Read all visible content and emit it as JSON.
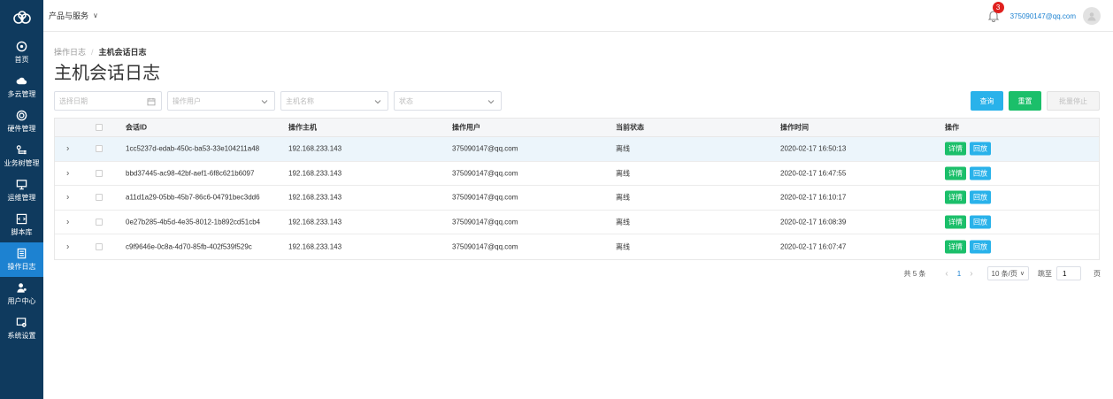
{
  "sidebar": {
    "logo_icon": "cloud-rings-logo-icon",
    "items": [
      {
        "label": "首页",
        "icon": "dashboard-icon"
      },
      {
        "label": "多云管理",
        "icon": "cloud-icon"
      },
      {
        "label": "硬件管理",
        "icon": "gear-ring-icon"
      },
      {
        "label": "业务树管理",
        "icon": "tree-icon"
      },
      {
        "label": "运维管理",
        "icon": "monitor-icon"
      },
      {
        "label": "脚本库",
        "icon": "code-icon"
      },
      {
        "label": "操作日志",
        "icon": "document-icon",
        "active": true
      },
      {
        "label": "用户中心",
        "icon": "user-icon"
      },
      {
        "label": "系统设置",
        "icon": "settings-icon"
      }
    ]
  },
  "topbar": {
    "product_menu": "产品与服务",
    "notification_count": "3",
    "user_email": "375090147@qq.com"
  },
  "breadcrumb": {
    "parent": "操作日志",
    "separator": "/",
    "current": "主机会话日志"
  },
  "page_title": "主机会话日志",
  "filters": {
    "date_placeholder": "选择日期",
    "user_placeholder": "操作用户",
    "host_placeholder": "主机名称",
    "status_placeholder": "状态"
  },
  "buttons": {
    "query": "查询",
    "reset": "重置",
    "batch_stop": "批量停止"
  },
  "table": {
    "headers": {
      "session_id": "会话ID",
      "host": "操作主机",
      "user": "操作用户",
      "status": "当前状态",
      "time": "操作时间",
      "actions": "操作"
    },
    "action_labels": {
      "detail": "详情",
      "replay": "回放"
    },
    "rows": [
      {
        "session_id": "1cc5237d-edab-450c-ba53-33e104211a48",
        "host": "192.168.233.143",
        "user": "375090147@qq.com",
        "status": "离线",
        "time": "2020-02-17 16:50:13"
      },
      {
        "session_id": "bbd37445-ac98-42bf-aef1-6f8c621b6097",
        "host": "192.168.233.143",
        "user": "375090147@qq.com",
        "status": "离线",
        "time": "2020-02-17 16:47:55"
      },
      {
        "session_id": "a11d1a29-05bb-45b7-86c6-04791bec3dd6",
        "host": "192.168.233.143",
        "user": "375090147@qq.com",
        "status": "离线",
        "time": "2020-02-17 16:10:17"
      },
      {
        "session_id": "0e27b285-4b5d-4e35-8012-1b892cd51cb4",
        "host": "192.168.233.143",
        "user": "375090147@qq.com",
        "status": "离线",
        "time": "2020-02-17 16:08:39"
      },
      {
        "session_id": "c9f9646e-0c8a-4d70-85fb-402f539f529c",
        "host": "192.168.233.143",
        "user": "375090147@qq.com",
        "status": "离线",
        "time": "2020-02-17 16:07:47"
      }
    ]
  },
  "pagination": {
    "total_text": "共 5 条",
    "current_page": "1",
    "page_size": "10 条/页",
    "goto_label": "跳至",
    "goto_value": "1",
    "page_unit": "页"
  },
  "colors": {
    "sidebar_bg": "#0f3a5e",
    "active": "#1d82d1",
    "query": "#29b2ea",
    "reset": "#1bbf6a"
  }
}
